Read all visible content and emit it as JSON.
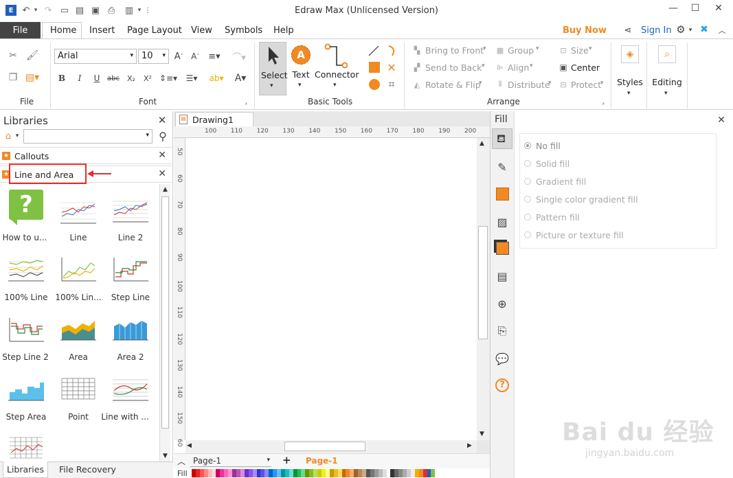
{
  "app": {
    "title": "Edraw Max (Unlicensed Version)"
  },
  "menu": {
    "file": "File",
    "tabs": [
      "Home",
      "Insert",
      "Page Layout",
      "View",
      "Symbols",
      "Help"
    ],
    "buy_now": "Buy Now",
    "sign_in": "Sign In"
  },
  "ribbon": {
    "file_group": "File",
    "font_group": "Font",
    "font_name": "Arial",
    "font_size": "10",
    "basic_tools_group": "Basic Tools",
    "select": "Select",
    "text": "Text",
    "connector": "Connector",
    "arrange_group": "Arrange",
    "bring_to_front": "Bring to Front",
    "send_to_back": "Send to Back",
    "rotate_flip": "Rotate & Flip",
    "group": "Group",
    "align": "Align",
    "distribute": "Distribute",
    "size": "Size",
    "center": "Center",
    "protect": "Protect",
    "styles": "Styles",
    "editing": "Editing"
  },
  "libraries": {
    "title": "Libraries",
    "sections": [
      "Callouts",
      "Line and Area"
    ],
    "items": [
      "How to u...",
      "Line",
      "Line 2",
      "100% Line",
      "100% Lin...",
      "Step Line",
      "Step Line 2",
      "Area",
      "Area 2",
      "Step Area",
      "Point",
      "Line with ..."
    ],
    "bottom_tabs": [
      "Libraries",
      "File Recovery"
    ]
  },
  "canvas": {
    "tab": "Drawing1",
    "hruler": [
      "100",
      "110",
      "120",
      "130",
      "140",
      "150",
      "160",
      "170",
      "180",
      "190",
      "200"
    ],
    "vruler": [
      "50",
      "60",
      "70",
      "80",
      "90",
      "100",
      "110",
      "120",
      "130",
      "140",
      "150",
      "60"
    ],
    "page_select": "Page-1",
    "page_tab": "Page-1",
    "fill_label": "Fill"
  },
  "fill_panel": {
    "title": "Fill",
    "options": [
      "No fill",
      "Solid fill",
      "Gradient fill",
      "Single color gradient fill",
      "Pattern fill",
      "Picture or texture fill"
    ],
    "selected": "No fill"
  },
  "colors": {
    "accent_orange": "#f08a24",
    "file_tab_bg": "#444444",
    "highlight_red": "#e03030",
    "sign_in_blue": "#1e5fbf"
  },
  "watermark": {
    "text": "Bai du 经验",
    "sub": "jingyan.baidu.com"
  }
}
